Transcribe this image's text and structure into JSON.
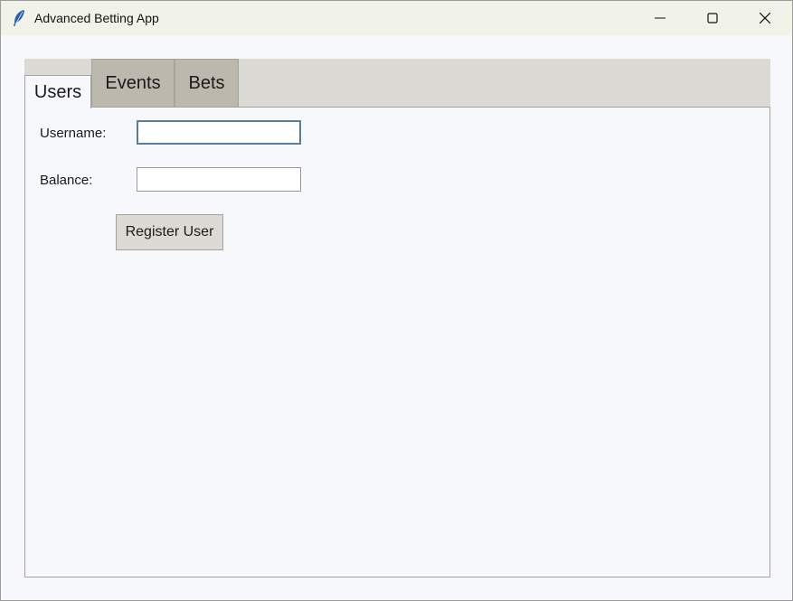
{
  "window": {
    "title": "Advanced Betting App",
    "icon": "feather-icon",
    "controls": [
      "minimize-icon",
      "maximize-icon",
      "close-icon"
    ]
  },
  "tabs": [
    {
      "label": "Users",
      "active": true
    },
    {
      "label": "Events",
      "active": false
    },
    {
      "label": "Bets",
      "active": false
    }
  ],
  "users_form": {
    "username_label": "Username:",
    "username_value": "",
    "balance_label": "Balance:",
    "balance_value": "",
    "register_button": "Register User"
  },
  "colors": {
    "titlebar": "#f2f3e8",
    "tabstrip": "#dcdad5",
    "inactive_tab": "#bdb8ae",
    "panel": "#f7f8fb",
    "focus_border": "#5a7d9a"
  }
}
